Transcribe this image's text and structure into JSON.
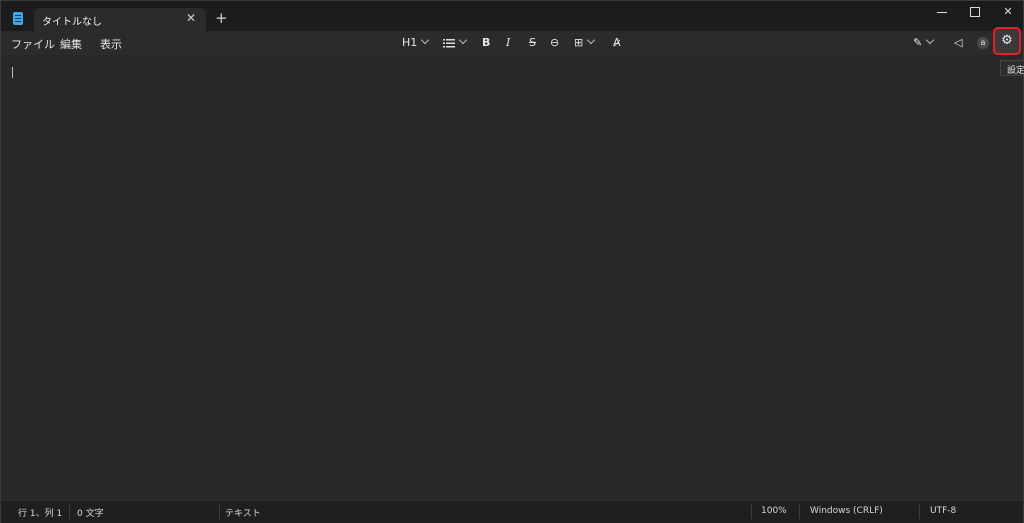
{
  "tab": {
    "title": "タイトルなし",
    "close": "✕",
    "new": "+"
  },
  "window": {
    "close": "✕"
  },
  "menu": [
    "ファイル",
    "編集",
    "表示"
  ],
  "toolbar": {
    "heading": "H1",
    "bold": "B",
    "italic": "I",
    "strike": "S",
    "link": "⊖",
    "table": "⊞",
    "clear_format": "A̷",
    "copilot": "✎",
    "announce": "◁",
    "account": "a",
    "settings": "⚙"
  },
  "tooltip": {
    "settings": "設定"
  },
  "status": {
    "position": "行 1、列 1",
    "chars": "0 文字",
    "mode": "テキスト",
    "zoom": "100%",
    "line_ending": "Windows (CRLF)",
    "encoding": "UTF-8"
  },
  "icons": [
    "notepad-app-icon",
    "close-icon",
    "plus-icon",
    "minimize-icon",
    "maximize-icon",
    "list-icon",
    "bold-icon",
    "italic-icon",
    "strikethrough-icon",
    "link-icon",
    "table-icon",
    "clear-format-icon",
    "copilot-icon",
    "megaphone-icon",
    "account-icon",
    "gear-icon"
  ],
  "colors": {
    "highlight": "#e0212b",
    "accent": "#3fa6e8"
  }
}
